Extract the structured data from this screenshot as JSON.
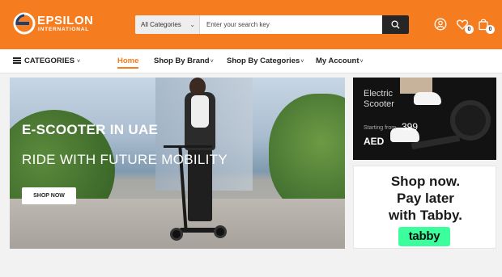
{
  "brand": {
    "name": "EPSILON",
    "tagline": "INTERNATIONAL",
    "accent_color": "#f57c1f"
  },
  "search": {
    "category": "All Categories",
    "placeholder": "Enter your search key",
    "value": ""
  },
  "header_icons": {
    "account": "user-icon",
    "wishlist_count": "0",
    "cart_count": "0"
  },
  "nav": {
    "categories_label": "CATEGORIES",
    "items": [
      {
        "label": "Home"
      },
      {
        "label": "Shop By Brand"
      },
      {
        "label": "Shop By Categories"
      },
      {
        "label": "My Account"
      }
    ]
  },
  "hero": {
    "headline": "E-SCOOTER IN UAE",
    "subheadline": "RIDE WITH FUTURE MOBILITY",
    "cta": "SHOP NOW"
  },
  "promo_scooter": {
    "title_line1": "Electric",
    "title_line2": "Scooter",
    "starting_label": "Starting from",
    "price": "399",
    "currency": "AED"
  },
  "promo_tabby": {
    "line1": "Shop now.",
    "line2": "Pay later",
    "line3": "with Tabby.",
    "logo_text": "tabby",
    "logo_color": "#3bff9d"
  }
}
